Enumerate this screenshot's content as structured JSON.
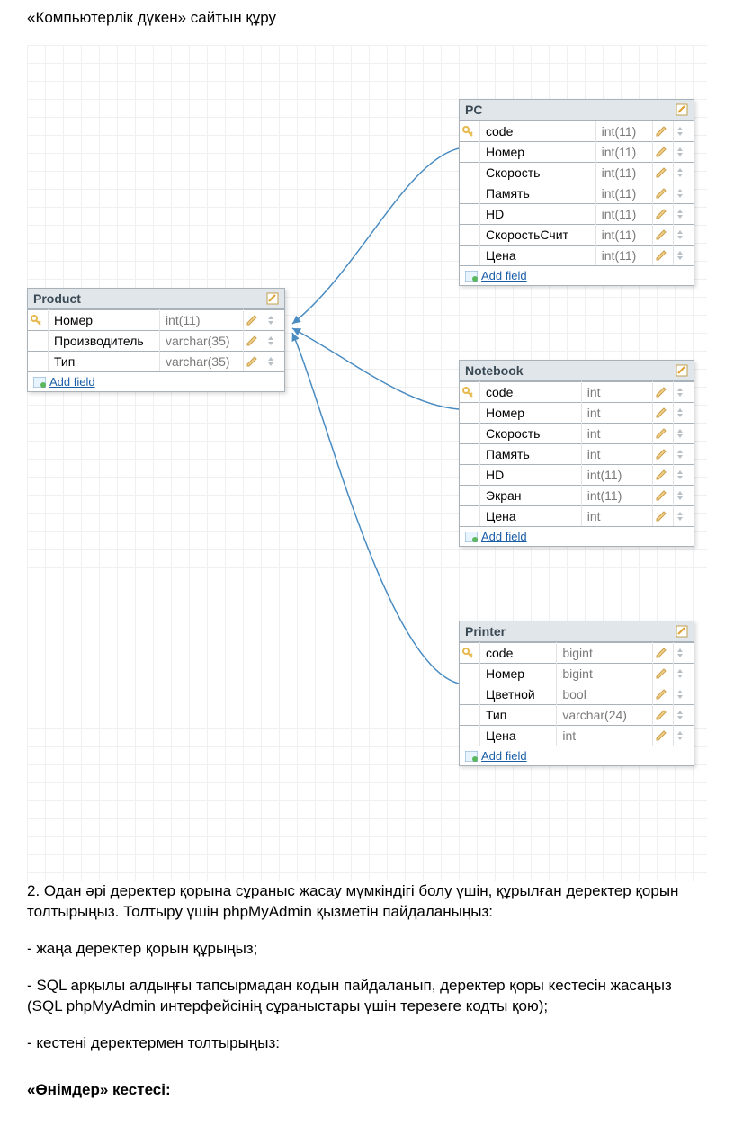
{
  "title": "«Компьютерлік дүкен» сайтын құру",
  "add_field_label": "Add field",
  "tables": {
    "product": {
      "name": "Product",
      "fields": [
        {
          "key": true,
          "name": "Номер",
          "type": "int(11)"
        },
        {
          "key": false,
          "name": "Производитель",
          "type": "varchar(35)"
        },
        {
          "key": false,
          "name": "Тип",
          "type": "varchar(35)"
        }
      ]
    },
    "pc": {
      "name": "PC",
      "fields": [
        {
          "key": true,
          "name": "code",
          "type": "int(11)"
        },
        {
          "key": false,
          "name": "Номер",
          "type": "int(11)"
        },
        {
          "key": false,
          "name": "Скорость",
          "type": "int(11)"
        },
        {
          "key": false,
          "name": "Память",
          "type": "int(11)"
        },
        {
          "key": false,
          "name": "HD",
          "type": "int(11)"
        },
        {
          "key": false,
          "name": "СкоростьСчит",
          "type": "int(11)"
        },
        {
          "key": false,
          "name": "Цена",
          "type": "int(11)"
        }
      ]
    },
    "notebook": {
      "name": "Notebook",
      "fields": [
        {
          "key": true,
          "name": "code",
          "type": "int"
        },
        {
          "key": false,
          "name": "Номер",
          "type": "int"
        },
        {
          "key": false,
          "name": "Скорость",
          "type": "int"
        },
        {
          "key": false,
          "name": "Память",
          "type": "int"
        },
        {
          "key": false,
          "name": "HD",
          "type": "int(11)"
        },
        {
          "key": false,
          "name": "Экран",
          "type": "int(11)"
        },
        {
          "key": false,
          "name": "Цена",
          "type": "int"
        }
      ]
    },
    "printer": {
      "name": "Printer",
      "fields": [
        {
          "key": true,
          "name": "code",
          "type": "bigint"
        },
        {
          "key": false,
          "name": "Номер",
          "type": "bigint"
        },
        {
          "key": false,
          "name": "Цветной",
          "type": "bool"
        },
        {
          "key": false,
          "name": "Тип",
          "type": "varchar(24)"
        },
        {
          "key": false,
          "name": "Цена",
          "type": "int"
        }
      ]
    }
  },
  "paragraphs": {
    "p1": "2. Одан әрі деректер қорына сұраныс жасау мүмкіндігі болу үшін, құрылған деректер қорын толтырыңыз. Толтыру үшін phpMyAdmin қызметін пайдаланыңыз:",
    "p2": "- жаңа деректер қорын құрыңыз;",
    "p3": "- SQL арқылы алдыңғы тапсырмадан кодын пайдаланып, деректер қоры кестесін жасаңыз (SQL phpMyAdmin интерфейсінің сұраныстары үшін терезеге кодты қою);",
    "p4": "- кестені деректермен толтырыңыз:"
  },
  "heading2": "«Өнімдер» кестесі:"
}
